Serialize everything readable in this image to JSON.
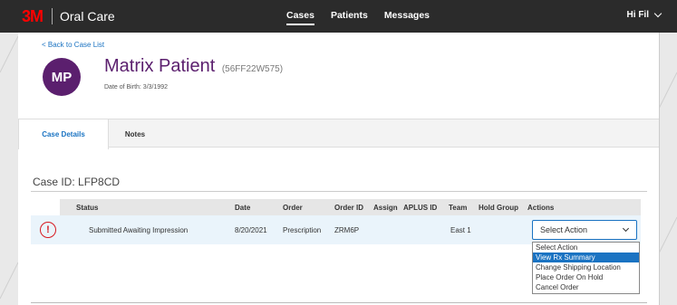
{
  "brand": {
    "logo": "3M",
    "app_title": "Oral Care"
  },
  "nav": {
    "items": [
      "Cases",
      "Patients",
      "Messages"
    ],
    "active": "Cases"
  },
  "user": {
    "greeting": "Hi Fil"
  },
  "back_link": "< Back to Case List",
  "patient": {
    "initials": "MP",
    "name": "Matrix Patient",
    "id": "(56FF22W575)",
    "dob": "Date of Birth: 3/3/1992",
    "avatar_color": "#5b1f6e"
  },
  "tabs": [
    {
      "label": "Case Details",
      "active": true
    },
    {
      "label": "Notes",
      "active": false
    }
  ],
  "case_id": "Case ID: LFP8CD",
  "table": {
    "headers": [
      "Status",
      "Date",
      "Order",
      "Order ID",
      "Assign",
      "APLUS ID",
      "Team",
      "Hold Group",
      "Actions"
    ],
    "rows": [
      {
        "status_icon": "alert-icon",
        "status": "Submitted Awaiting Impression",
        "date": "8/20/2021",
        "order": "Prescription",
        "order_id": "ZRM6P",
        "assign": "",
        "aplus_id": "",
        "team": "East 1",
        "hold_group": "",
        "action_select": "Select Action"
      }
    ]
  },
  "action_options": [
    "Select Action",
    "View Rx Summary",
    "Change Shipping Location",
    "Place Order On Hold",
    "Cancel Order"
  ],
  "highlighted_option": "View Rx Summary",
  "colors": {
    "accent": "#1a73c2",
    "topbar": "#2b2b2b",
    "alert": "#d71920",
    "row_bg": "#eaf4fb"
  }
}
